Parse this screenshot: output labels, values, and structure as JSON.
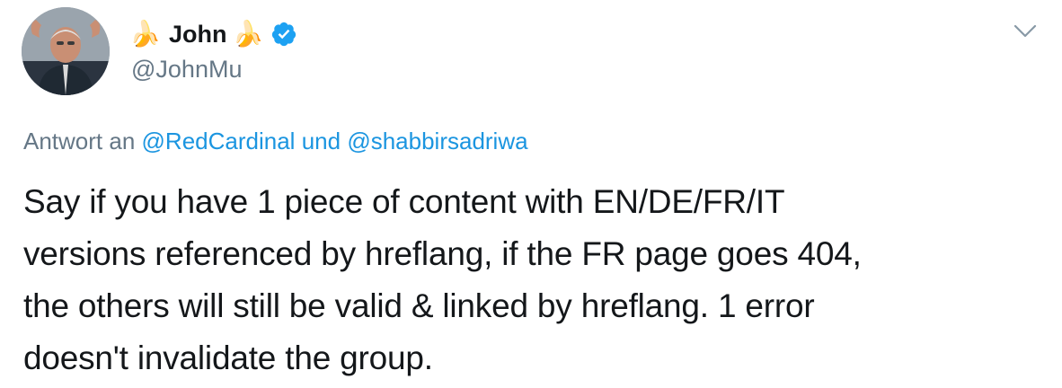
{
  "author": {
    "display_name": "John",
    "name_prefix_emoji": "🍌",
    "name_suffix_emoji": "🍌",
    "handle": "@JohnMu",
    "verified": true
  },
  "reply": {
    "prefix": "Antwort an",
    "mention_1": "@RedCardinal",
    "conjunction": "und",
    "mention_2": "@shabbirsadriwa"
  },
  "tweet": {
    "lines": [
      "Say if you have 1 piece of content with EN/DE/FR/IT",
      "versions referenced by hreflang, if the FR page goes 404,",
      "the others will still be valid & linked by hreflang. 1 error",
      "doesn't invalidate the group."
    ]
  },
  "colors": {
    "link": "#1b95e0",
    "secondary_text": "#657786",
    "primary_text": "#14171a",
    "verified_badge": "#1da1f2"
  },
  "icons": {
    "verified": "verified-badge-icon",
    "menu": "chevron-down-icon"
  }
}
